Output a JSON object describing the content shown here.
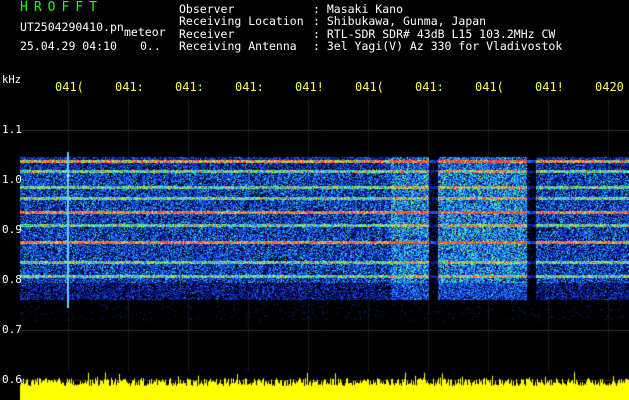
{
  "header": {
    "app_title": "HROFFT",
    "file_name": "UT2504290410.pn",
    "file_tag": "meteor",
    "date_time": "25.04.29 04:10",
    "date_extra": "0..",
    "info": [
      {
        "key": "Observer",
        "value": ": Masaki Kano"
      },
      {
        "key": "Receiving Location",
        "value": ": Shibukawa, Gunma, Japan"
      },
      {
        "key": "Receiver",
        "value": ": RTL-SDR SDR# 43dB L15 103.2MHz CW"
      },
      {
        "key": "Receiving Antenna",
        "value": ": 3el Yagi(V) Az 330 for Vladivostok"
      }
    ]
  },
  "axis": {
    "unit": "kHz",
    "time_ticks": [
      "041(",
      "041:",
      "041:",
      "041:",
      "041!",
      "041(",
      "041:",
      "041(",
      "041!",
      "0420"
    ],
    "freq_ticks": [
      "1.1",
      "1.0",
      "0.9",
      "0.8",
      "0.7",
      "0.6"
    ]
  },
  "colors": {
    "background": "#000000",
    "title_green": "#1aff1a",
    "tick_yellow": "#ffff55",
    "power_trace": "#ffff00"
  }
}
